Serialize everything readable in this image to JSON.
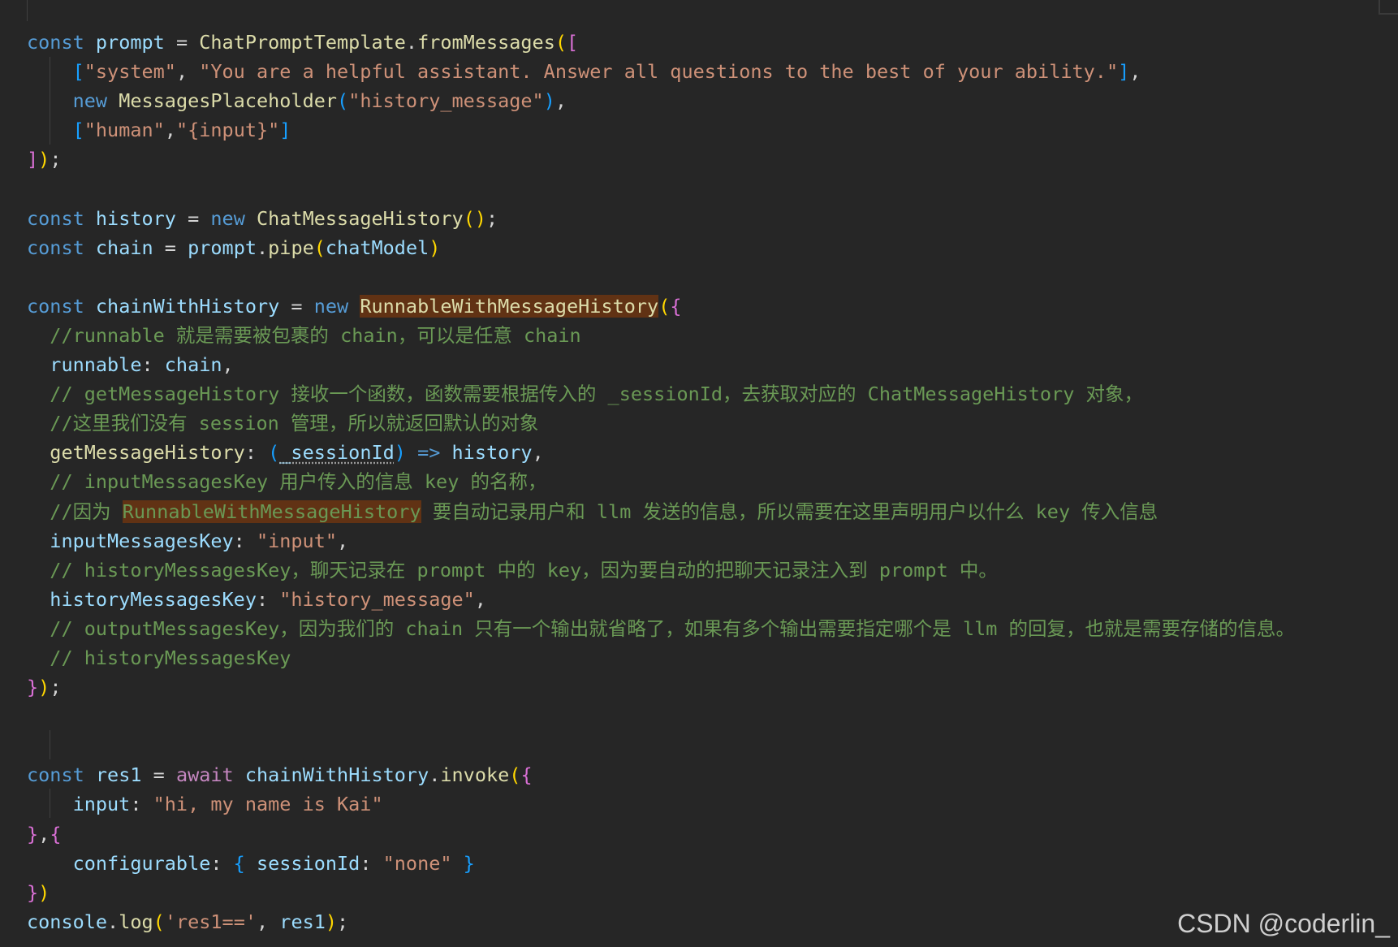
{
  "editor": {
    "theme_colors": {
      "background": "#262626",
      "keyword": "#569cd6",
      "control_keyword": "#c586c0",
      "variable": "#9cdcfe",
      "class_name": "#dcdcaa",
      "string": "#ce9178",
      "comment": "#6a9955",
      "bracket_level_1": "#ffd700",
      "bracket_level_2": "#da70d6",
      "bracket_level_3": "#179fff",
      "highlight": "#613214"
    },
    "lines": [
      {
        "tokens": [
          {
            "t": "const",
            "c": "kw"
          },
          {
            "t": " "
          },
          {
            "t": "prompt",
            "c": "var"
          },
          {
            "t": " = "
          },
          {
            "t": "ChatPromptTemplate",
            "c": "cls"
          },
          {
            "t": "."
          },
          {
            "t": "fromMessages",
            "c": "fn"
          },
          {
            "t": "(",
            "c": "br1"
          },
          {
            "t": "[",
            "c": "br2"
          }
        ]
      },
      {
        "tokens": [
          {
            "t": "    "
          },
          {
            "t": "[",
            "c": "br3"
          },
          {
            "t": "\"system\"",
            "c": "str"
          },
          {
            "t": ", "
          },
          {
            "t": "\"You are a helpful assistant. Answer all questions to the best of your ability.\"",
            "c": "str"
          },
          {
            "t": "]",
            "c": "br3"
          },
          {
            "t": ","
          }
        ]
      },
      {
        "tokens": [
          {
            "t": "    "
          },
          {
            "t": "new",
            "c": "kw"
          },
          {
            "t": " "
          },
          {
            "t": "MessagesPlaceholder",
            "c": "cls"
          },
          {
            "t": "(",
            "c": "br3"
          },
          {
            "t": "\"history_message\"",
            "c": "str"
          },
          {
            "t": ")",
            "c": "br3"
          },
          {
            "t": ","
          }
        ]
      },
      {
        "tokens": [
          {
            "t": "    "
          },
          {
            "t": "[",
            "c": "br3"
          },
          {
            "t": "\"human\"",
            "c": "str"
          },
          {
            "t": ","
          },
          {
            "t": "\"{input}\"",
            "c": "str"
          },
          {
            "t": "]",
            "c": "br3"
          }
        ]
      },
      {
        "tokens": [
          {
            "t": "]",
            "c": "br2"
          },
          {
            "t": ")",
            "c": "br1"
          },
          {
            "t": ";"
          }
        ]
      },
      {
        "tokens": []
      },
      {
        "tokens": [
          {
            "t": "const",
            "c": "kw"
          },
          {
            "t": " "
          },
          {
            "t": "history",
            "c": "var"
          },
          {
            "t": " = "
          },
          {
            "t": "new",
            "c": "kw"
          },
          {
            "t": " "
          },
          {
            "t": "ChatMessageHistory",
            "c": "cls"
          },
          {
            "t": "()",
            "c": "br1"
          },
          {
            "t": ";"
          }
        ]
      },
      {
        "tokens": [
          {
            "t": "const",
            "c": "kw"
          },
          {
            "t": " "
          },
          {
            "t": "chain",
            "c": "var"
          },
          {
            "t": " = "
          },
          {
            "t": "prompt",
            "c": "var"
          },
          {
            "t": "."
          },
          {
            "t": "pipe",
            "c": "fn"
          },
          {
            "t": "(",
            "c": "br1"
          },
          {
            "t": "chatModel",
            "c": "var"
          },
          {
            "t": ")",
            "c": "br1"
          }
        ]
      },
      {
        "tokens": []
      },
      {
        "tokens": [
          {
            "t": "const",
            "c": "kw"
          },
          {
            "t": " "
          },
          {
            "t": "chainWithHistory",
            "c": "var"
          },
          {
            "t": " = "
          },
          {
            "t": "new",
            "c": "kw"
          },
          {
            "t": " "
          },
          {
            "t": "RunnableWithMessageHistory",
            "c": "cls hl"
          },
          {
            "t": "(",
            "c": "br1"
          },
          {
            "t": "{",
            "c": "br2"
          }
        ]
      },
      {
        "tokens": [
          {
            "t": "  "
          },
          {
            "t": "//runnable 就是需要被包裹的 chain，可以是任意 chain",
            "c": "com"
          }
        ]
      },
      {
        "tokens": [
          {
            "t": "  "
          },
          {
            "t": "runnable",
            "c": "prop"
          },
          {
            "t": ": "
          },
          {
            "t": "chain",
            "c": "var"
          },
          {
            "t": ","
          }
        ]
      },
      {
        "tokens": [
          {
            "t": "  "
          },
          {
            "t": "// getMessageHistory 接收一个函数，函数需要根据传入的 _sessionId，去获取对应的 ChatMessageHistory 对象，",
            "c": "com"
          }
        ]
      },
      {
        "tokens": [
          {
            "t": "  "
          },
          {
            "t": "//这里我们没有 session 管理，所以就返回默认的对象",
            "c": "com"
          }
        ]
      },
      {
        "tokens": [
          {
            "t": "  "
          },
          {
            "t": "getMessageHistory",
            "c": "fn"
          },
          {
            "t": ": "
          },
          {
            "t": "(",
            "c": "br3"
          },
          {
            "t": "_sessionId",
            "c": "var squiggle"
          },
          {
            "t": ")",
            "c": "br3"
          },
          {
            "t": " "
          },
          {
            "t": "=>",
            "c": "kw"
          },
          {
            "t": " "
          },
          {
            "t": "history",
            "c": "var"
          },
          {
            "t": ","
          }
        ]
      },
      {
        "tokens": [
          {
            "t": "  "
          },
          {
            "t": "// inputMessagesKey 用户传入的信息 key 的名称，",
            "c": "com"
          }
        ]
      },
      {
        "tokens": [
          {
            "t": "  "
          },
          {
            "t": "//因为 ",
            "c": "com"
          },
          {
            "t": "RunnableWithMessageHistory",
            "c": "com hl"
          },
          {
            "t": " 要自动记录用户和 llm 发送的信息，所以需要在这里声明用户以什么 key 传入信息",
            "c": "com"
          }
        ]
      },
      {
        "tokens": [
          {
            "t": "  "
          },
          {
            "t": "inputMessagesKey",
            "c": "prop"
          },
          {
            "t": ": "
          },
          {
            "t": "\"input\"",
            "c": "str"
          },
          {
            "t": ","
          }
        ]
      },
      {
        "tokens": [
          {
            "t": "  "
          },
          {
            "t": "// historyMessagesKey，聊天记录在 prompt 中的 key，因为要自动的把聊天记录注入到 prompt 中。",
            "c": "com"
          }
        ]
      },
      {
        "tokens": [
          {
            "t": "  "
          },
          {
            "t": "historyMessagesKey",
            "c": "prop"
          },
          {
            "t": ": "
          },
          {
            "t": "\"history_message\"",
            "c": "str"
          },
          {
            "t": ","
          }
        ]
      },
      {
        "tokens": [
          {
            "t": "  "
          },
          {
            "t": "// outputMessagesKey，因为我们的 chain 只有一个输出就省略了，如果有多个输出需要指定哪个是 llm 的回复，也就是需要存储的信息。",
            "c": "com"
          }
        ]
      },
      {
        "tokens": [
          {
            "t": "  "
          },
          {
            "t": "// historyMessagesKey",
            "c": "com"
          }
        ]
      },
      {
        "tokens": [
          {
            "t": "}",
            "c": "br2"
          },
          {
            "t": ")",
            "c": "br1"
          },
          {
            "t": ";"
          }
        ]
      },
      {
        "tokens": []
      },
      {
        "tokens": []
      },
      {
        "tokens": [
          {
            "t": "const",
            "c": "kw"
          },
          {
            "t": " "
          },
          {
            "t": "res1",
            "c": "var"
          },
          {
            "t": " = "
          },
          {
            "t": "await",
            "c": "ctrl"
          },
          {
            "t": " "
          },
          {
            "t": "chainWithHistory",
            "c": "var"
          },
          {
            "t": "."
          },
          {
            "t": "invoke",
            "c": "fn"
          },
          {
            "t": "(",
            "c": "br1"
          },
          {
            "t": "{",
            "c": "br2"
          }
        ]
      },
      {
        "tokens": [
          {
            "t": "    "
          },
          {
            "t": "input",
            "c": "prop"
          },
          {
            "t": ": "
          },
          {
            "t": "\"hi, my name is Kai\"",
            "c": "str"
          }
        ]
      },
      {
        "tokens": [
          {
            "t": "}",
            "c": "br2"
          },
          {
            "t": ","
          },
          {
            "t": "{",
            "c": "br2"
          }
        ]
      },
      {
        "tokens": [
          {
            "t": "    "
          },
          {
            "t": "configurable",
            "c": "prop"
          },
          {
            "t": ": "
          },
          {
            "t": "{",
            "c": "br3"
          },
          {
            "t": " "
          },
          {
            "t": "sessionId",
            "c": "prop"
          },
          {
            "t": ": "
          },
          {
            "t": "\"none\"",
            "c": "str"
          },
          {
            "t": " "
          },
          {
            "t": "}",
            "c": "br3"
          }
        ]
      },
      {
        "tokens": [
          {
            "t": "}",
            "c": "br2"
          },
          {
            "t": ")",
            "c": "br1"
          }
        ]
      },
      {
        "tokens": [
          {
            "t": "console",
            "c": "var"
          },
          {
            "t": "."
          },
          {
            "t": "log",
            "c": "fn"
          },
          {
            "t": "(",
            "c": "br1"
          },
          {
            "t": "'res1=='",
            "c": "str"
          },
          {
            "t": ", "
          },
          {
            "t": "res1",
            "c": "var"
          },
          {
            "t": ")",
            "c": "br1"
          },
          {
            "t": ";"
          }
        ]
      }
    ]
  },
  "watermark": {
    "text": "CSDN @coderlin_"
  }
}
